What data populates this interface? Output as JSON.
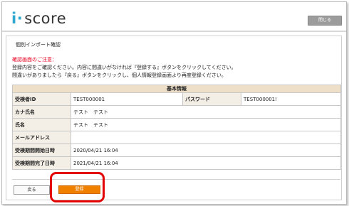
{
  "header": {
    "logo_i": "i",
    "logo_dot": "·",
    "logo_rest": "score",
    "close_label": "閉じる"
  },
  "page_title": "個別インポート確認",
  "notice": {
    "title": "確認画面のご注意：",
    "lines": [
      "登録内容をご確認ください。内容に間違いがなければ『登録する』ボタンをクリックしてください。",
      "間違いがありましたら『戻る』ボタンをクリックし、個人情報登録画面より再度登録ください。"
    ]
  },
  "table": {
    "section_title": "基本情報",
    "rows": {
      "id_label": "受検者ID",
      "id_value": "TEST000001",
      "pw_label": "パスワード",
      "pw_value": "TEST000001!",
      "kana_label": "カナ氏名",
      "kana_value": "テスト　テスト",
      "name_label": "氏名",
      "name_value": "テスト　テスト",
      "mail_label": "メールアドレス",
      "mail_value": "",
      "start_label": "受検期間開始日時",
      "start_value": "2020/04/21 16:04",
      "end_label": "受検期間完了日時",
      "end_value": "2021/04/21 16:04"
    }
  },
  "buttons": {
    "back_label": "戻る",
    "register_label": "登録"
  },
  "colors": {
    "accent": "#f08000",
    "highlight": "#e20000",
    "header_bg": "#eedfc9"
  }
}
